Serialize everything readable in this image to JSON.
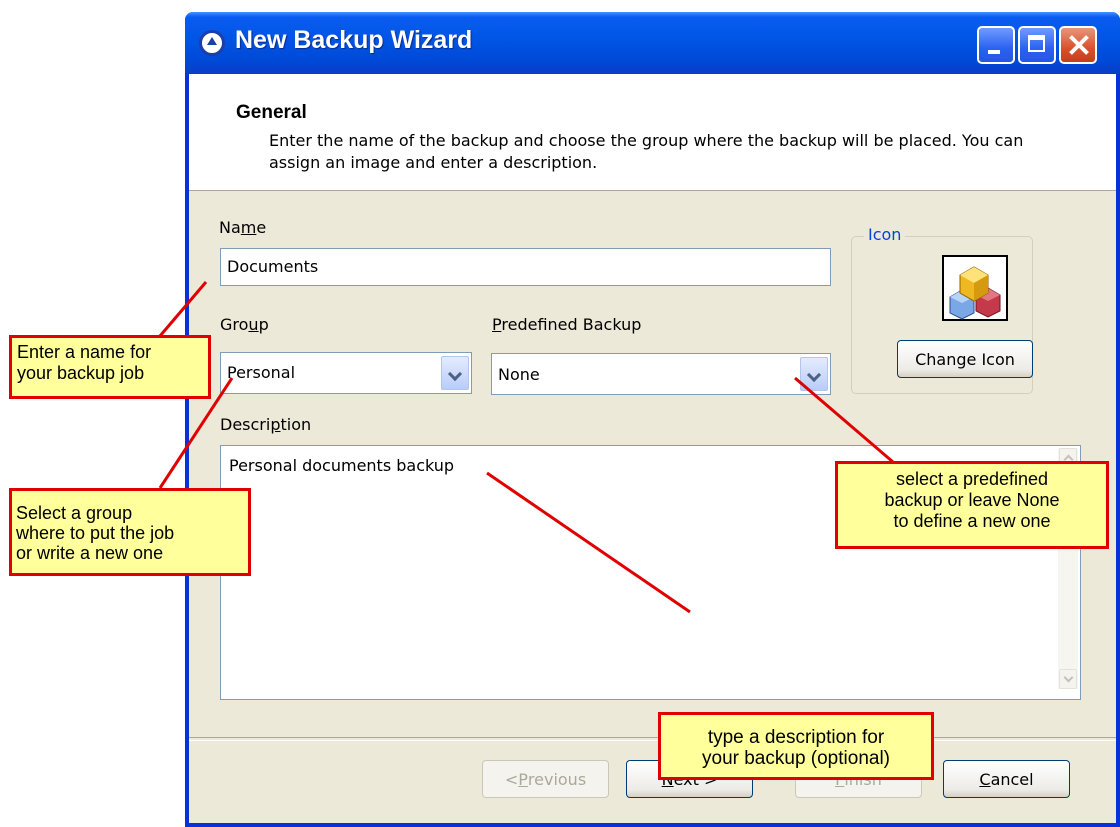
{
  "window": {
    "title": "New Backup Wizard"
  },
  "header": {
    "title": "General",
    "description": "Enter the name of the backup and choose the group where the backup will be placed. You can assign an image and enter a description."
  },
  "form": {
    "name_label_pre": "Na",
    "name_label_u": "m",
    "name_label_post": "e",
    "name_value": "Documents",
    "group_label_pre": "Gro",
    "group_label_u": "u",
    "group_label_post": "p",
    "group_value": "Personal",
    "predefined_label_u": "P",
    "predefined_label_post": "redefined Backup",
    "predefined_value": "None",
    "description_label_pre": "Descri",
    "description_label_u": "p",
    "description_label_post": "tion",
    "description_value": "Personal documents backup"
  },
  "icon_group": {
    "legend": "Icon",
    "change_button": "Change Icon",
    "icon": "colored-cubes-icon"
  },
  "buttons": {
    "previous_pre": "< ",
    "previous_u": "P",
    "previous_post": "revious",
    "next_u": "N",
    "next_post": "ext >",
    "finish_u": "F",
    "finish_post": "inish",
    "cancel_u": "C",
    "cancel_post": "ancel"
  },
  "callouts": {
    "name": "Enter a name for\nyour backup job",
    "group": "Select a group\nwhere to put the job\nor write a new one",
    "predefined": "select a predefined\nbackup or leave None\nto define a new one",
    "description": "type a description for\nyour backup (optional)"
  },
  "colors": {
    "callout_fill": "#ffff9b",
    "callout_border": "#e00000",
    "titlebar": "#0055e5"
  }
}
